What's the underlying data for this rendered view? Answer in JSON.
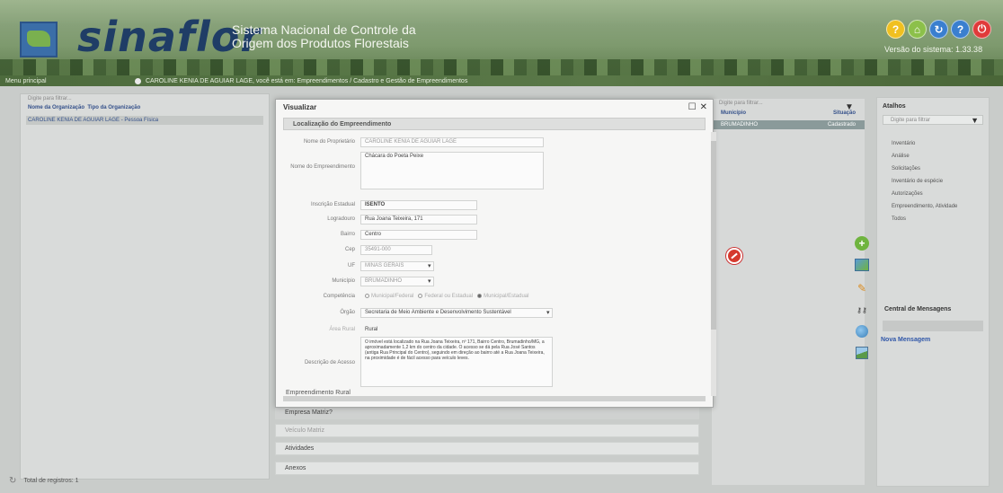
{
  "header": {
    "brand": "sinaflor",
    "tagline_line1": "Sistema Nacional de Controle da",
    "tagline_line2": "Origem dos Produtos Florestais",
    "version": "Versão do sistema: 1.33.38",
    "icons": [
      {
        "name": "help-icon",
        "glyph": "?",
        "color": "#f0c020"
      },
      {
        "name": "home-icon",
        "glyph": "⌂",
        "color": "#8cc04a"
      },
      {
        "name": "refresh-icon",
        "glyph": "↻",
        "color": "#3a7fcf"
      },
      {
        "name": "info-icon",
        "glyph": "?",
        "color": "#3a7fcf"
      },
      {
        "name": "power-icon",
        "glyph": "⏻",
        "color": "#e03a3a"
      }
    ]
  },
  "breadcrumb": {
    "menu": "Menu principal",
    "text": "CAROLINE KENIA DE AGUIAR LAGE, você está em: Empreendimentos / Cadastro e Gestão de Empreendimentos"
  },
  "left_panel": {
    "search_placeholder": "Digite para filtrar...",
    "col1": "Nome da Organização",
    "col2": "Tipo da Organização",
    "row": "CAROLINE KENIA DE AGUIAR LAGE - Pessoa Física",
    "total": "Total de registros: 1"
  },
  "modal": {
    "title": "Visualizar",
    "section": "Localização do Empreendimento",
    "fields": {
      "nome_label": "Nome do Proprietário",
      "nome_value": "CAROLINE KENIA DE AGUIAR LAGE",
      "empreend_label": "Nome do Empreendimento",
      "empreend_value": "Chácara do Poeta Peixe",
      "ie_label": "Inscrição Estadual",
      "ie_value": "ISENTO",
      "logradouro_label": "Logradouro",
      "logradouro_value": "Rua Joana Teixeira, 171",
      "bairro_label": "Bairro",
      "bairro_value": "Centro",
      "cep_label": "Cep",
      "cep_value": "35491-000",
      "uf_label": "UF",
      "uf_value": "MINAS GERAIS",
      "municipio_label": "Município",
      "municipio_value": "BRUMADINHO",
      "competencia_label": "Competência",
      "competencia_opts": [
        "Municipal/Federal",
        "Federal ou Estadual",
        "Municipal/Estadual"
      ],
      "orgao_label": "Órgão",
      "orgao_value": "Secretaria de Meio Ambiente e Desenvolvimento Sustentável",
      "area_label": "Área Rural",
      "area_value": "Rural",
      "acesso_label": "Descrição de Acesso",
      "acesso_value": "O imóvel está localizado na Rua Joana Teixeira, nº 171, Bairro Centro, Brumadinho/MG, a aproximadamente 1,2 km do centro da cidade. O acesso se dá pela Rua José Santos (antiga Rua Principal do Centro), seguindo em direção ao bairro até a Rua Joana Teixeira, na proximidade é de fácil acesso para veículo leves.",
      "rural_label": "Empreendimento Rural"
    }
  },
  "accordion": {
    "empresa": "Empresa Matriz?",
    "veiculo": "Veículo Matriz",
    "atividades": "Atividades",
    "anexos": "Anexos"
  },
  "mid_panel": {
    "search_placeholder": "Digite para filtrar...",
    "col1": "Município",
    "col2": "Situação",
    "row_city": "BRUMADINHO",
    "row_status": "Cadastrado"
  },
  "right_panel": {
    "title": "Atalhos",
    "filter_placeholder": "Digite para filtrar",
    "items": [
      "Inventário",
      "Análise",
      "Solicitações",
      "Inventário de espécie",
      "Autorizações",
      "Empreendimento, Atividade",
      "Todos"
    ],
    "messages_title": "Central de Mensagens",
    "new_message": "Nova Mensagem"
  }
}
